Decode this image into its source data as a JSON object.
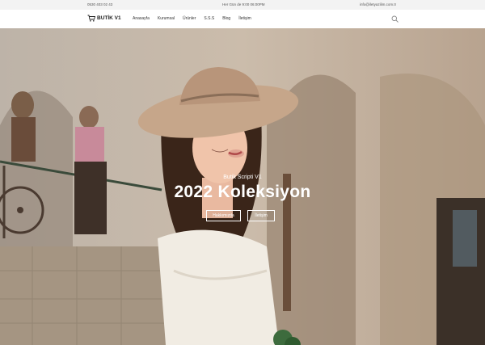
{
  "topbar": {
    "phone": "0530 403 02 43",
    "hours": "Her Gün de 9:00 06:00PM",
    "email": "info@iletyazilim.com.tr"
  },
  "nav": {
    "logo_text": "BUTİK V1",
    "menu": [
      "Anasayfa",
      "Kurumsal",
      "Ürünler",
      "S.S.S",
      "Blog",
      "İletişim"
    ],
    "icons": [
      "cart-icon",
      "search-icon"
    ]
  },
  "hero": {
    "subtitle": "Butik Scripti V1",
    "title": "2022 Koleksiyon",
    "buttons": [
      "Hakkımızda",
      "İletişim"
    ]
  },
  "colors": {
    "topbar_bg": "#f3f3f3",
    "nav_bg": "#ffffff",
    "hero_text": "#ffffff"
  }
}
